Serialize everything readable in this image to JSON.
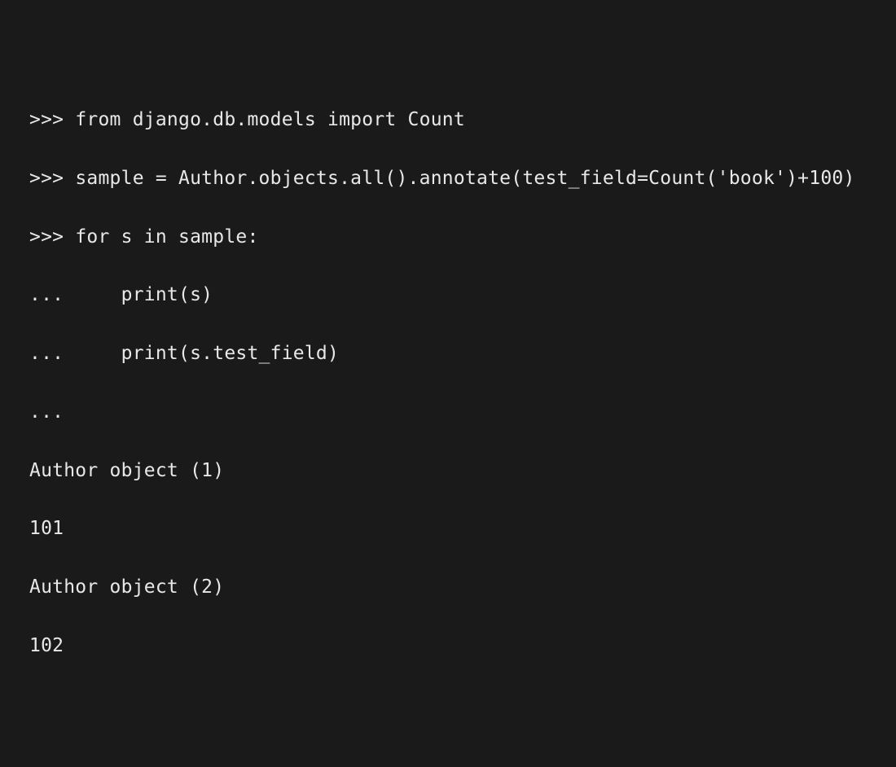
{
  "terminal": {
    "lines": [
      {
        "prompt": ">>> ",
        "text": "from django.db.models import Count"
      },
      {
        "prompt": ">>> ",
        "text": "sample = Author.objects.all().annotate(test_field=Count('book')+100)"
      },
      {
        "prompt": ">>> ",
        "text": "for s in sample:"
      },
      {
        "prompt": "...     ",
        "text": "print(s)"
      },
      {
        "prompt": "...     ",
        "text": "print(s.test_field)"
      },
      {
        "prompt": "... ",
        "text": ""
      },
      {
        "prompt": "",
        "text": "Author object (1)"
      },
      {
        "prompt": "",
        "text": "101"
      },
      {
        "prompt": "",
        "text": "Author object (2)"
      },
      {
        "prompt": "",
        "text": "102"
      }
    ]
  }
}
